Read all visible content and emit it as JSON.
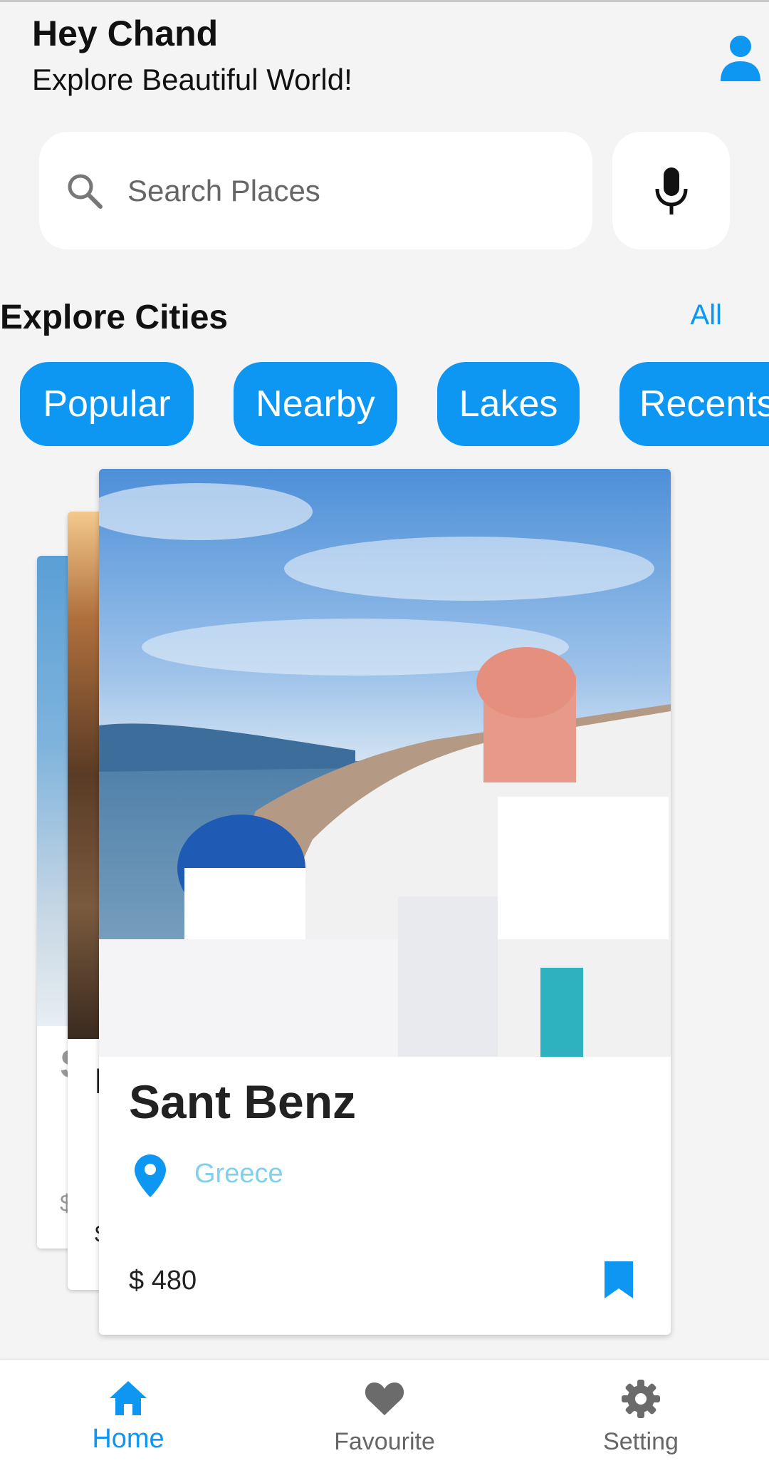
{
  "header": {
    "greeting": "Hey Chand",
    "subtitle": "Explore Beautiful World!"
  },
  "search": {
    "placeholder": "Search Places"
  },
  "section": {
    "title": "Explore Cities",
    "all_label": "All"
  },
  "categories": [
    "Popular",
    "Nearby",
    "Lakes",
    "Recents"
  ],
  "cards": {
    "back1": {
      "title_partial": "S",
      "price_partial": "$"
    },
    "back2": {
      "title_partial": "I",
      "price_partial": "$"
    },
    "main": {
      "title": "Sant Benz",
      "country": "Greece",
      "price": "$ 480"
    }
  },
  "nav": {
    "home": "Home",
    "favourite": "Favourite",
    "setting": "Setting"
  },
  "colors": {
    "accent": "#0d96f2",
    "country_text": "#7fd0ef",
    "background": "#f4f4f4"
  },
  "icons": {
    "profile": "person-icon",
    "search": "search-icon",
    "mic": "mic-icon",
    "location": "location-pin-icon",
    "bookmark": "bookmark-icon",
    "home": "home-icon",
    "favourite": "heart-icon",
    "setting": "gear-icon"
  }
}
